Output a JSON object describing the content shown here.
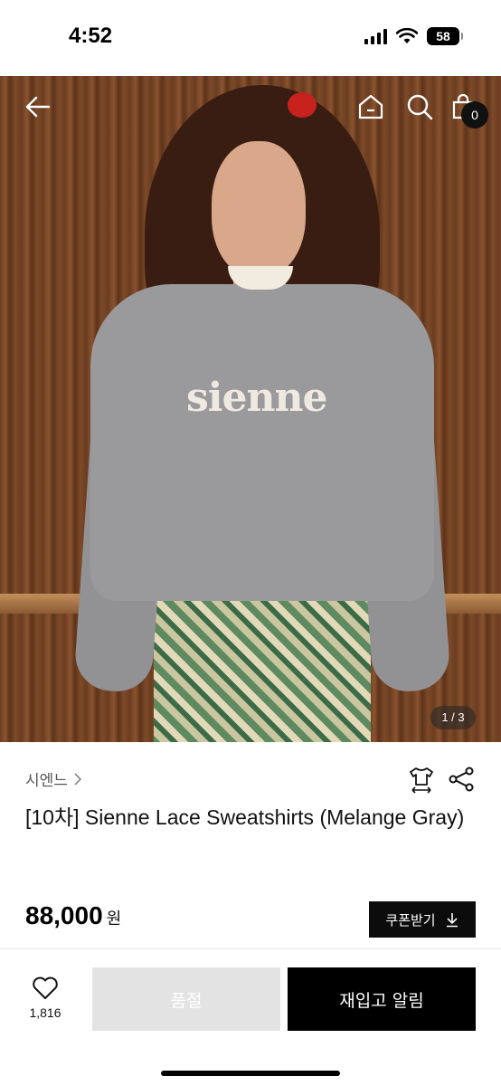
{
  "status_bar": {
    "time": "4:52",
    "battery": "58"
  },
  "top_nav": {
    "cart_count": "0"
  },
  "gallery": {
    "image_logo_text": "sienne",
    "counter": "1 / 3"
  },
  "product": {
    "brand": "시엔느",
    "title": "[10차] Sienne Lace Sweatshirts (Melange Gray)",
    "price": "88,000",
    "currency": "원",
    "coupon_label": "쿠폰받기"
  },
  "bottom_bar": {
    "like_count": "1,816",
    "soldout_label": "품절",
    "restock_label": "재입고 알림"
  },
  "colors": {
    "primary": "#000000",
    "disabled": "#e3e3e3",
    "text_muted": "#555555"
  },
  "icons": [
    "back-arrow-icon",
    "home-icon",
    "search-icon",
    "shopping-bag-icon",
    "chevron-right-icon",
    "shirt-size-icon",
    "share-icon",
    "download-icon",
    "heart-icon"
  ]
}
